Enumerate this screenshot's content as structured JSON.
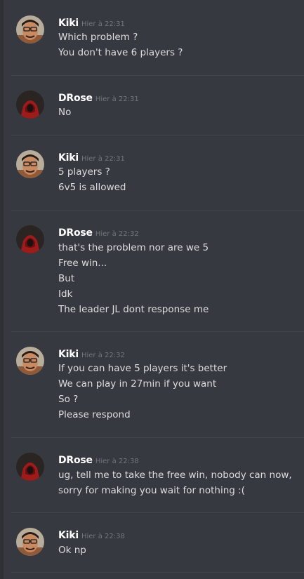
{
  "messages": [
    {
      "author": "Kiki",
      "timestamp": "Hier à 22:31",
      "avatar": "kiki-avatar",
      "lines": [
        "Which problem ?",
        "You don't have 6 players ?"
      ]
    },
    {
      "author": "DRose",
      "timestamp": "Hier à 22:31",
      "avatar": "drose-avatar",
      "lines": [
        "No"
      ]
    },
    {
      "author": "Kiki",
      "timestamp": "Hier à 22:31",
      "avatar": "kiki-avatar",
      "lines": [
        "5 players ?",
        "6v5 is allowed"
      ]
    },
    {
      "author": "DRose",
      "timestamp": "Hier à 22:32",
      "avatar": "drose-avatar",
      "lines": [
        "that's the problem nor are we 5",
        "Free win...",
        "But",
        "Idk",
        "The leader JL dont response me"
      ]
    },
    {
      "author": "Kiki",
      "timestamp": "Hier à 22:32",
      "avatar": "kiki-avatar",
      "lines": [
        "If you can have 5 players it's better",
        "We can play in 27min if you want",
        "So ?",
        "Please respond"
      ]
    },
    {
      "author": "DRose",
      "timestamp": "Hier à 22:38",
      "avatar": "drose-avatar",
      "lines": [
        "ug, tell me to take the free win, nobody can now,",
        "sorry for making you wait for nothing :("
      ]
    },
    {
      "author": "Kiki",
      "timestamp": "Hier à 22:38",
      "avatar": "kiki-avatar",
      "lines": [
        "Ok np"
      ]
    }
  ],
  "colors": {
    "background": "#36393f",
    "username": "#ffffff",
    "timestamp": "#72767d",
    "message_text": "#dcddde",
    "divider": "#42454a"
  }
}
